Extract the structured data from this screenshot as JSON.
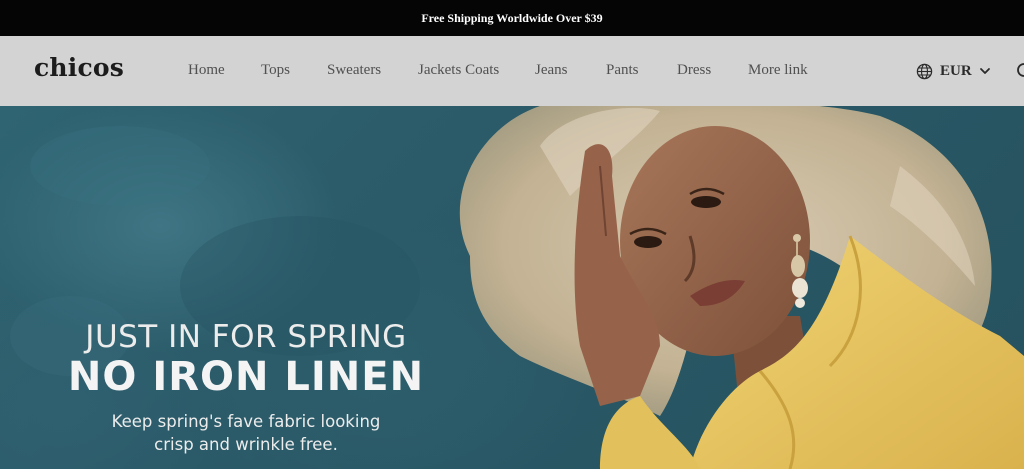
{
  "announcement": {
    "text": "Free Shipping Worldwide Over $39"
  },
  "header": {
    "logo": "chicos",
    "nav": [
      {
        "label": "Home"
      },
      {
        "label": "Tops"
      },
      {
        "label": "Sweaters"
      },
      {
        "label": "Jackets Coats"
      },
      {
        "label": "Jeans"
      },
      {
        "label": "Pants"
      },
      {
        "label": "Dress"
      },
      {
        "label": "More link"
      }
    ],
    "currency": {
      "label": "EUR",
      "icon": "globe-icon",
      "caret_icon": "chevron-down-icon"
    },
    "search_icon": "search-icon"
  },
  "hero": {
    "kicker": "JUST IN FOR SPRING",
    "headline": "NO IRON LINEN",
    "subtext_line1": "Keep spring's fave fabric looking",
    "subtext_line2": "crisp and wrinkle free.",
    "colors": {
      "background": "#2f6472",
      "shirt": "#e8c45a",
      "hair": "#cdbda3",
      "skin": "#9a6a4e"
    }
  }
}
